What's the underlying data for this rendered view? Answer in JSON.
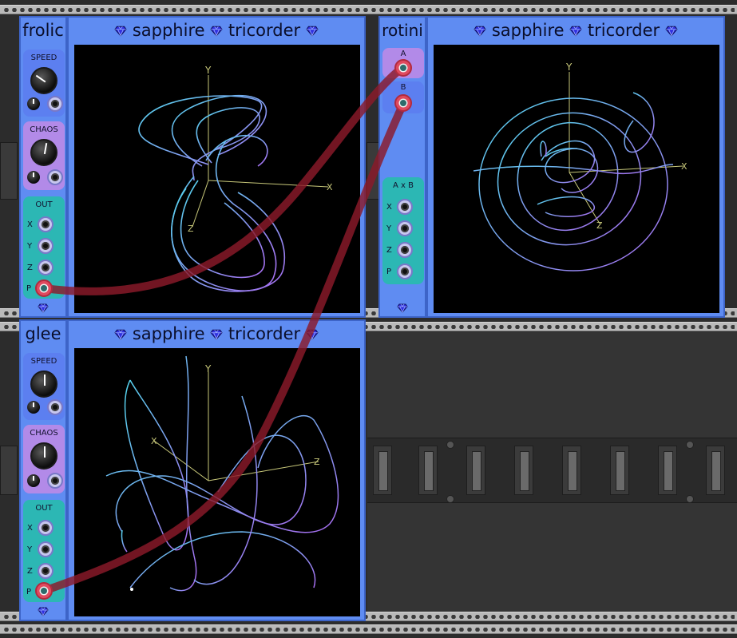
{
  "modules": {
    "frolic": {
      "title": "frolic",
      "speed_label": "SPEED",
      "chaos_label": "CHAOS",
      "out_label": "OUT",
      "outputs": [
        "X",
        "Y",
        "Z",
        "P"
      ]
    },
    "glee": {
      "title": "glee",
      "speed_label": "SPEED",
      "chaos_label": "CHAOS",
      "out_label": "OUT",
      "outputs": [
        "X",
        "Y",
        "Z",
        "P"
      ]
    },
    "rotini": {
      "title": "rotini",
      "input_a_label": "A",
      "input_b_label": "B",
      "out_label": "A x B",
      "outputs": [
        "X",
        "Y",
        "Z",
        "P"
      ]
    },
    "tricorder": {
      "brand": "sapphire",
      "name": "tricorder",
      "axis_x": "X",
      "axis_y": "Y",
      "axis_z": "Z"
    }
  },
  "colors": {
    "panel_blue": "#5f8cf2",
    "speed_section": "#5c7ff0",
    "chaos_section": "#b28ae8",
    "out_section": "#2cb7b4",
    "cable": "#8b1a2a",
    "trace_cyan": "#53d6ee",
    "trace_violet": "#a86cf0"
  },
  "icons": [
    "gem-icon",
    "knob-icon",
    "jack-icon",
    "plug-icon"
  ]
}
